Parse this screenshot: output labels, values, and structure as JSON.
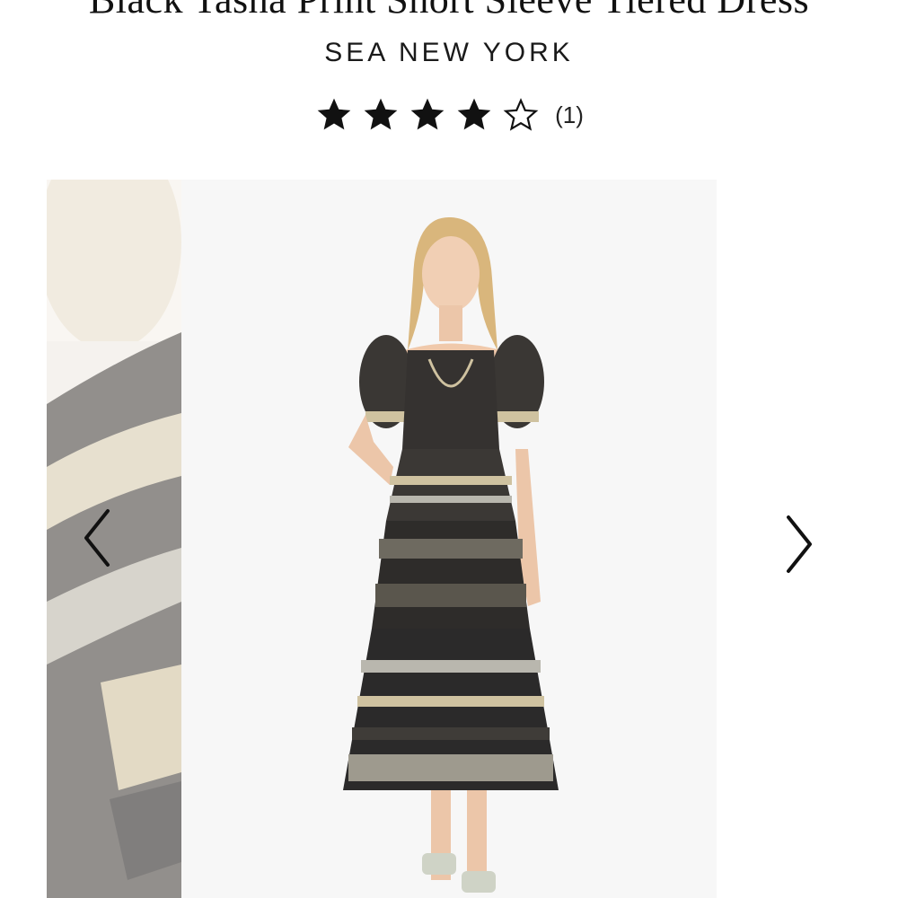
{
  "product": {
    "title": "Black Tasha Print Short Sleeve Tiered Dress",
    "brand": "SEA NEW YORK",
    "rating": 4,
    "rating_max": 5,
    "review_count": "(1)"
  },
  "carousel": {
    "prev_icon": "chevron-left-icon",
    "next_icon": "chevron-right-icon"
  },
  "colors": {
    "text": "#111111",
    "image_bg": "#f7f7f7",
    "dress_dark": "#2b2a2a",
    "dress_tan": "#cfc2a0",
    "dress_light": "#b9b7ae"
  }
}
